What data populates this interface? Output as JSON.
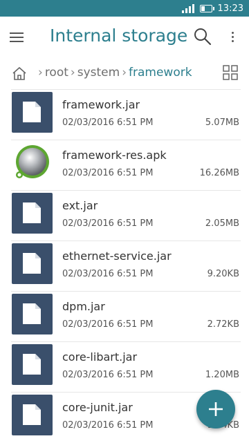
{
  "status": {
    "time": "13:23"
  },
  "app_bar": {
    "title": "Internal storage"
  },
  "breadcrumb": {
    "items": [
      "root",
      "system",
      "framework"
    ]
  },
  "files": [
    {
      "name": "framework.jar",
      "date": "02/03/2016 6:51 PM",
      "size": "5.07MB",
      "icon": "document-icon"
    },
    {
      "name": "framework-res.apk",
      "date": "02/03/2016 6:51 PM",
      "size": "16.26MB",
      "icon": "apk-icon"
    },
    {
      "name": "ext.jar",
      "date": "02/03/2016 6:51 PM",
      "size": "2.05MB",
      "icon": "document-icon"
    },
    {
      "name": "ethernet-service.jar",
      "date": "02/03/2016 6:51 PM",
      "size": "9.20KB",
      "icon": "document-icon"
    },
    {
      "name": "dpm.jar",
      "date": "02/03/2016 6:51 PM",
      "size": "2.72KB",
      "icon": "document-icon"
    },
    {
      "name": "core-libart.jar",
      "date": "02/03/2016 6:51 PM",
      "size": "1.20MB",
      "icon": "document-icon"
    },
    {
      "name": "core-junit.jar",
      "date": "02/03/2016 6:51 PM",
      "size": "11.4KB",
      "icon": "document-icon"
    }
  ],
  "colors": {
    "accent": "#2d7f8e",
    "thumb": "#3a4f6b"
  }
}
